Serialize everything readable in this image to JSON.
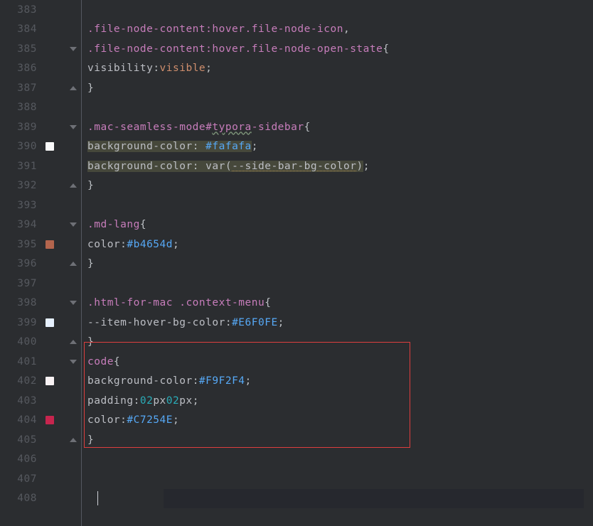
{
  "gutter": {
    "lines": [
      {
        "n": "383"
      },
      {
        "n": "384"
      },
      {
        "n": "385",
        "fold": "open"
      },
      {
        "n": "386"
      },
      {
        "n": "387",
        "fold": "close"
      },
      {
        "n": "388"
      },
      {
        "n": "389",
        "fold": "open"
      },
      {
        "n": "390",
        "swatch": "#fafafa"
      },
      {
        "n": "391"
      },
      {
        "n": "392",
        "fold": "close"
      },
      {
        "n": "393"
      },
      {
        "n": "394",
        "fold": "open"
      },
      {
        "n": "395",
        "swatch": "#b4654d"
      },
      {
        "n": "396",
        "fold": "close"
      },
      {
        "n": "397"
      },
      {
        "n": "398",
        "fold": "open"
      },
      {
        "n": "399",
        "swatch": "#e6f0fe"
      },
      {
        "n": "400",
        "fold": "close"
      },
      {
        "n": "401",
        "fold": "open"
      },
      {
        "n": "402",
        "swatch": "#f9f2f4"
      },
      {
        "n": "403"
      },
      {
        "n": "404",
        "swatch": "#c7254e"
      },
      {
        "n": "405",
        "fold": "close"
      },
      {
        "n": "406"
      },
      {
        "n": "407"
      },
      {
        "n": "408"
      }
    ]
  },
  "code": {
    "l383": "",
    "l384": {
      "sel1": ".file-node-content",
      "pseudo": ":hover",
      "sel2": " .file-node-icon",
      "comma": ","
    },
    "l385": {
      "sel1": ".file-node-content",
      "pseudo": ":hover",
      "sel2": " .file-node-open-state",
      "brace": "{"
    },
    "l386": {
      "prop": "visibility",
      "val": "visible",
      "semi": ";"
    },
    "l387": {
      "brace": "}"
    },
    "l388": "",
    "l389": {
      "sel1": ".mac-seamless-mode ",
      "id": "#",
      "typo": "typora",
      "rest": "-sidebar ",
      "brace": "{"
    },
    "l390": {
      "prop": "background-color",
      "val": "#fafafa",
      "semi": ";"
    },
    "l391": {
      "prop": "background-color",
      "fn": "var",
      "paren1": "(",
      "var": "--side-bar-bg-color",
      "paren2": ")",
      "semi": ";"
    },
    "l392": {
      "brace": "}"
    },
    "l393": "",
    "l394": {
      "sel": ".md-lang ",
      "brace": "{"
    },
    "l395": {
      "prop": "color",
      "val": "#b4654d",
      "semi": ";"
    },
    "l396": {
      "brace": "}"
    },
    "l397": "",
    "l398": {
      "sel": ".html-for-mac .context-menu ",
      "brace": "{"
    },
    "l399": {
      "prop": "--item-hover-bg-color",
      "val": "#E6F0FE",
      "semi": ";"
    },
    "l400": {
      "brace": "}"
    },
    "l401": {
      "sel": "code ",
      "brace": "{"
    },
    "l402": {
      "prop": "background-color",
      "val": "#F9F2F4",
      "semi": ";"
    },
    "l403": {
      "prop": "padding",
      "v1": "0",
      "v2": "2",
      "u2": "px",
      "v3": "0",
      "v4": "2",
      "u4": "px",
      "semi": ";"
    },
    "l404": {
      "prop": "color",
      "val": "#C7254E",
      "semi": ";"
    },
    "l405": {
      "brace": "}"
    },
    "l406": "",
    "l407": "",
    "l408": ""
  },
  "annotation": {
    "top_line": 401,
    "bottom_line": 405
  },
  "cursor_line": 408,
  "indent": "    "
}
